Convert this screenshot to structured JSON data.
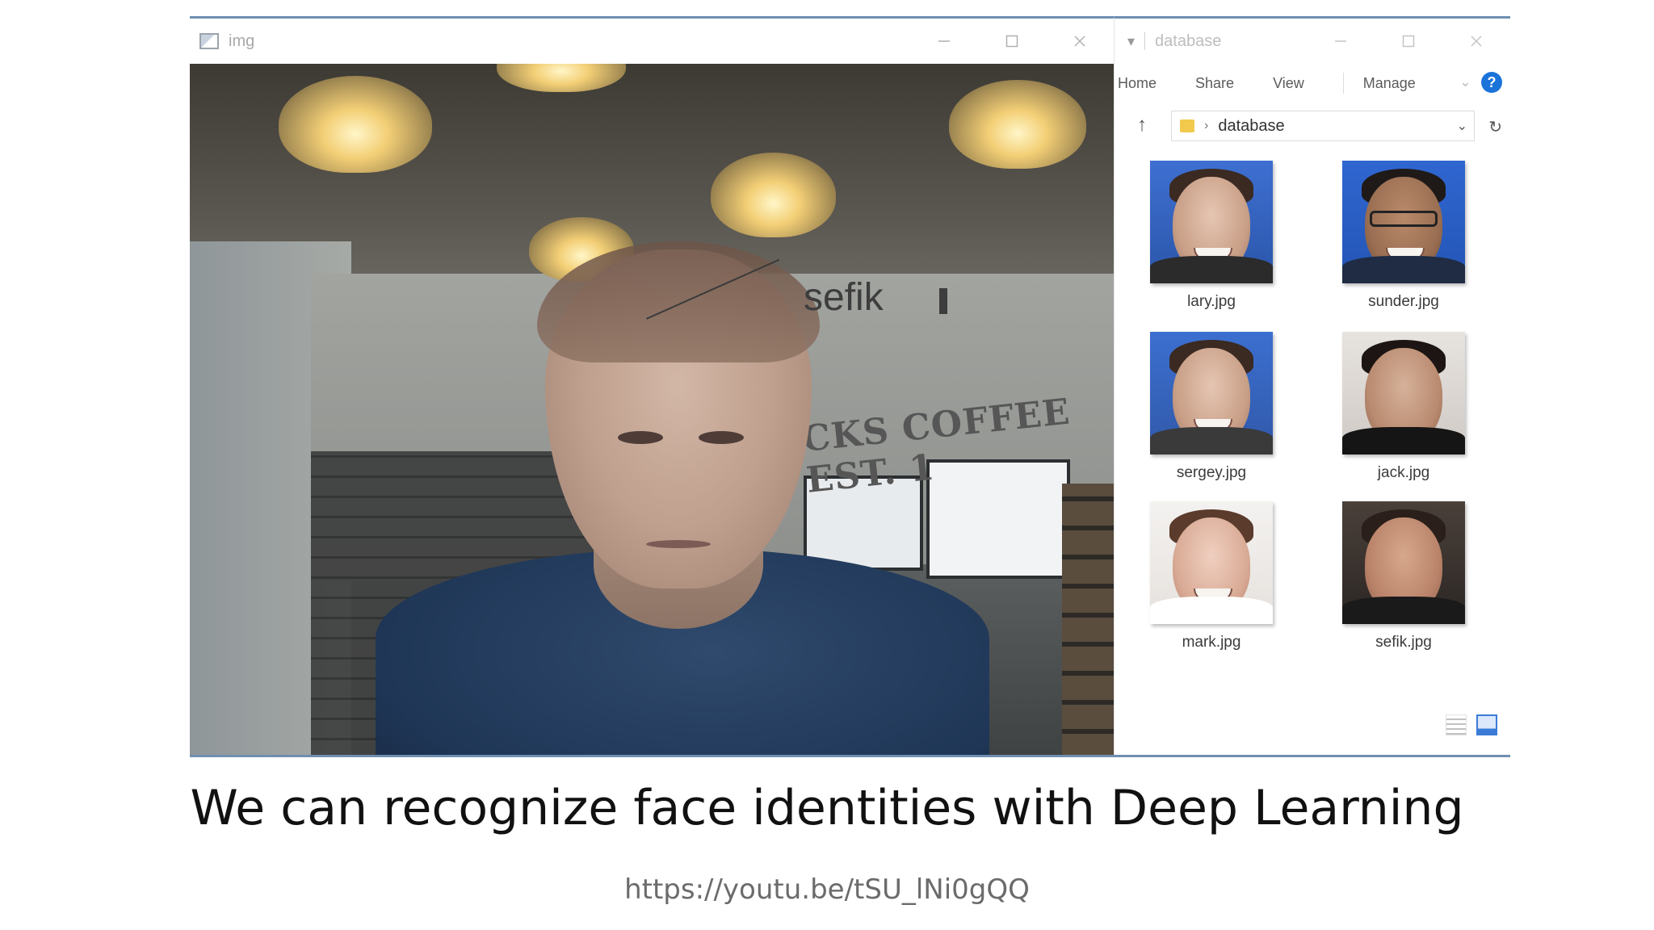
{
  "img_window": {
    "title": "img",
    "detected_label": "sefik",
    "wall_sign_text": "CKS COFFEE  EST. 1"
  },
  "explorer": {
    "title": "database",
    "ribbon_tabs": [
      "Home",
      "Share",
      "View",
      "Manage"
    ],
    "address_path": "database",
    "files": [
      {
        "name": "lary.jpg"
      },
      {
        "name": "sunder.jpg"
      },
      {
        "name": "sergey.jpg"
      },
      {
        "name": "jack.jpg"
      },
      {
        "name": "mark.jpg"
      },
      {
        "name": "sefik.jpg"
      }
    ]
  },
  "caption": "We can recognize face identities with Deep Learning",
  "link": "https://youtu.be/tSU_lNi0gQQ",
  "colors": {
    "window_border": "#6f8fb0",
    "help_badge": "#1a73d9",
    "folder": "#f2c94c"
  }
}
